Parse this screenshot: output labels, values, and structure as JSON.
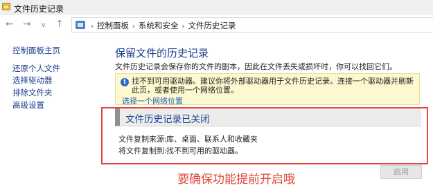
{
  "window": {
    "title": "文件历史记录",
    "icon": "folder-icon"
  },
  "nav": {
    "back_icon": "←",
    "forward_icon": "→",
    "dropdown_icon": "∨",
    "up_icon": "↑",
    "breadcrumb": [
      "控制面板",
      "系统和安全",
      "文件历史记录"
    ],
    "separator": "›"
  },
  "sidebar": {
    "items": [
      {
        "label": "控制面板主页"
      },
      {
        "label": "还原个人文件"
      },
      {
        "label": "选择驱动器"
      },
      {
        "label": "排除文件夹"
      },
      {
        "label": "高级设置"
      }
    ]
  },
  "main": {
    "heading": "保留文件的历史记录",
    "description": "文件历史记录会保存你的文件的副本，因此在文件丢失或损坏时，你可以找回它们。",
    "warning": {
      "icon": "info-icon",
      "icon_glyph": "i",
      "text": "找不到可用驱动器。建议你将外部驱动器用于文件历史记录。连接一个驱动器并刷新此页，或者使用一个网络位置。",
      "link": "选择一个网络位置"
    },
    "status": {
      "title": "文件历史记录已关闭",
      "source_label": "文件复制来源:",
      "source_value": "库、桌面、联系人和收藏夹",
      "dest_label": "将文件复制到:",
      "dest_value": "找不到可用的驱动器。"
    },
    "annotation": "要确保功能提前开启哦",
    "enable_button": "启用"
  },
  "colors": {
    "heading": "#1a3f8d",
    "link": "#1e5fb8",
    "warning_bg": "#fdf8cf",
    "annotation": "#e2453a"
  }
}
